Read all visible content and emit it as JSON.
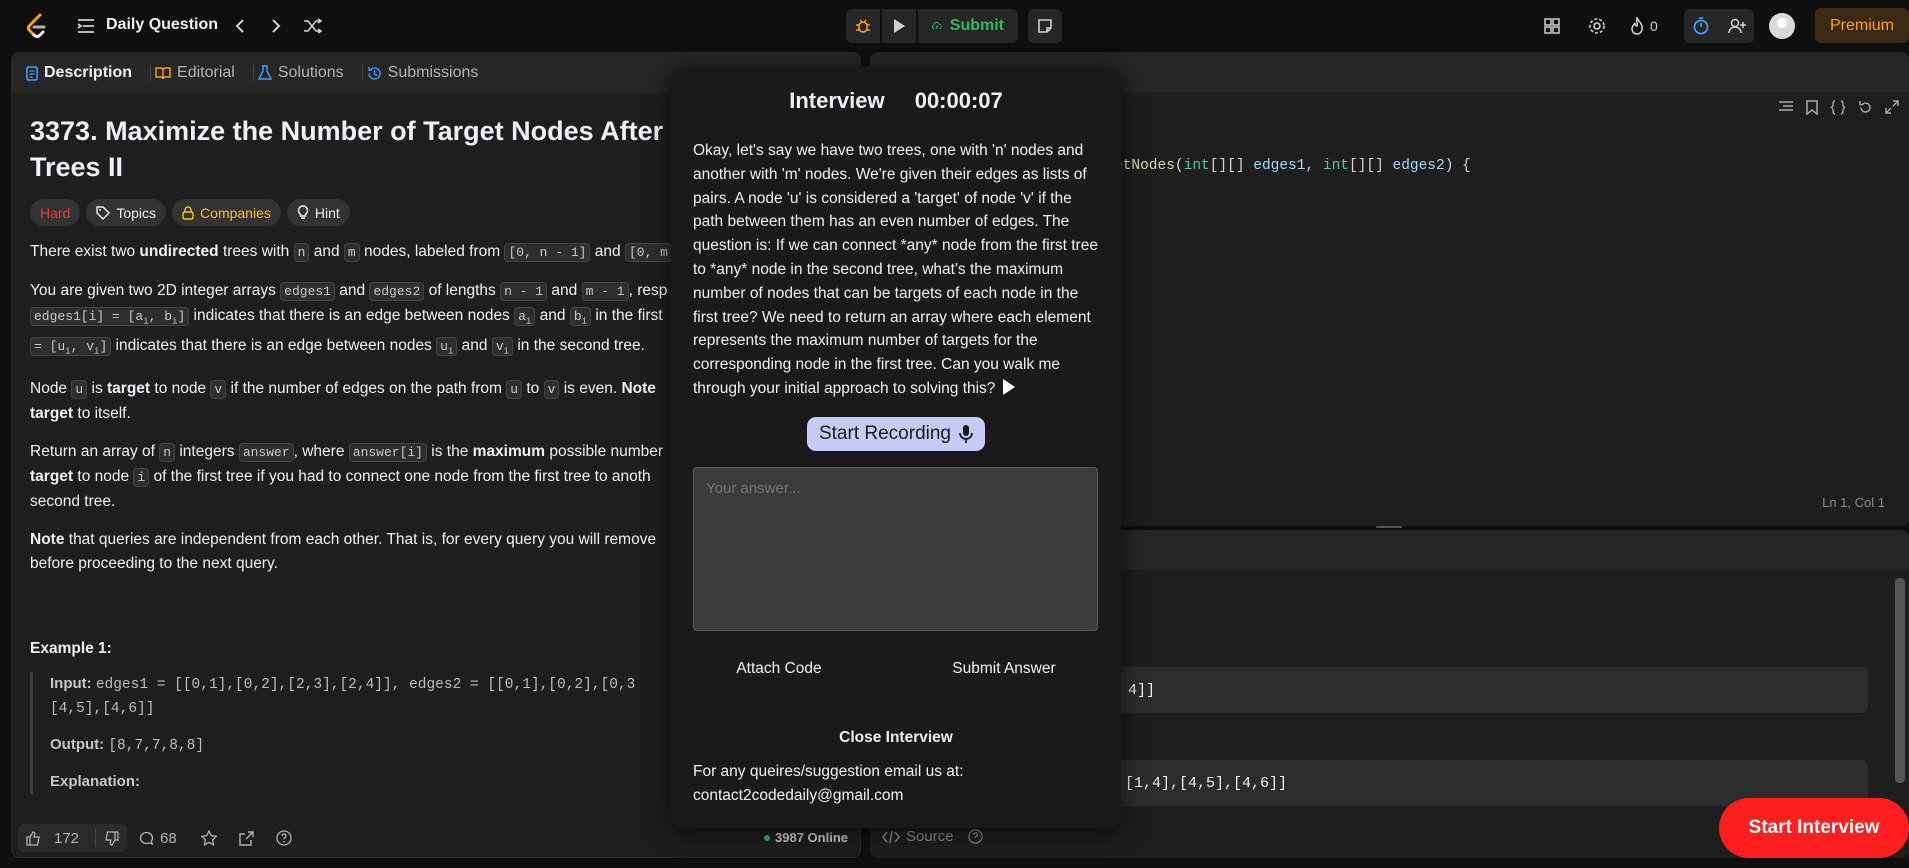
{
  "topbar": {
    "title": "Daily Question",
    "submit_label": "Submit",
    "streak_count": "0",
    "premium_label": "Premium"
  },
  "tabs": [
    "Description",
    "Editorial",
    "Solutions",
    "Submissions"
  ],
  "problem": {
    "title": "3373. Maximize the Number of Target Nodes After C",
    "title_line2": "Trees II",
    "badges": [
      "Hard",
      "Topics",
      "Companies",
      "Hint"
    ],
    "para1_a": "There exist two ",
    "para1_b": "undirected",
    "para1_c": " trees with ",
    "para1_d": " and ",
    "para1_e": " nodes, labeled from ",
    "para1_f": " and ",
    "code_n": "n",
    "code_m": "m",
    "code_range1": "[0, n - 1]",
    "code_range2": "[0, m",
    "para2_a": "You are given two 2D integer arrays ",
    "code_edges1": "edges1",
    "para2_b": " and ",
    "code_edges2": "edges2",
    "para2_c": " of lengths ",
    "code_n1": "n - 1",
    "para2_d": " and ",
    "code_m1": "m - 1",
    "para2_e": ", resp",
    "code_edges1i": "edges1[i] = [a",
    "para2_f": " indicates that there is an edge between nodes ",
    "para2_g": " and ",
    "para2_h": " in the first",
    "code_uv": "= [u",
    "para2_i": " indicates that there is an edge between nodes ",
    "para2_j": " and ",
    "para2_k": " in the second tree.",
    "para3_a": "Node ",
    "code_u": "u",
    "para3_b": " is ",
    "para3_c": "target",
    "para3_d": " to node ",
    "code_v": "v",
    "para3_e": " if the number of edges on the path from ",
    "para3_f": " to ",
    "para3_g": " is even. ",
    "para3_h": "Note",
    "para3_i": "target",
    "para3_j": " to itself.",
    "para4_a": "Return an array of ",
    "para4_b": " integers ",
    "code_answer": "answer",
    "para4_c": ", where ",
    "code_answeri": "answer[i]",
    "para4_d": " is the ",
    "para4_e": "maximum",
    "para4_f": " possible number",
    "para4_g": "target",
    "para4_h": " to node ",
    "code_i": "i",
    "para4_i": " of the first tree if you had to connect one node from the first tree to anoth",
    "para4_j": "second tree.",
    "para5_a": "Note",
    "para5_b": " that queries are independent from each other. That is, for every query you will remove",
    "para5_c": "before proceeding to the next query.",
    "example_title": "Example 1:",
    "ex_input_label": "Input:",
    "ex_input": "edges1 = [[0,1],[0,2],[2,3],[2,4]], edges2 = [[0,1],[0,2],[0,3",
    "ex_input2": "[4,5],[4,6]]",
    "ex_output_label": "Output:",
    "ex_output": "[8,7,7,8,8]",
    "ex_expl_label": "Explanation:"
  },
  "left_footer": {
    "likes": "172",
    "comments": "68",
    "online": "3987 Online"
  },
  "editor": {
    "code_fn": "etNodes",
    "code_rest_a": "(",
    "type1": "int",
    "arr1": "[][] ",
    "param1": "edges1",
    "comma": ", ",
    "type2": "int",
    "arr2": "[][] ",
    "param2": "edges2",
    "end": ") {",
    "position": "Ln 1, Col 1"
  },
  "testcases": {
    "case1": "4]]",
    "case2": "7],[1,4],[4,5],[4,6]]",
    "source_label": "Source"
  },
  "modal": {
    "title": "Interview",
    "timer": "00:00:07",
    "question": "Okay, let's say we have two trees, one with 'n' nodes and another with 'm' nodes. We're given their edges as lists of pairs. A node 'u' is considered a 'target' of node 'v' if the path between them has an even number of edges. The question is: If we can connect *any* node from the first tree to *any* node in the second tree, what's the maximum number of nodes that can be targets of each node in the first tree? We need to return an array where each element represents the maximum number of targets for the corresponding node in the first tree. Can you walk me through your initial approach to solving this?",
    "record_label": "Start Recording",
    "answer_placeholder": "Your answer...",
    "attach_label": "Attach Code",
    "submit_answer_label": "Submit Answer",
    "close_label": "Close Interview",
    "footer_line1": "For any queires/suggestion email us at:",
    "footer_line2": "contact2codedaily@gmail.com"
  },
  "start_interview_label": "Start Interview"
}
